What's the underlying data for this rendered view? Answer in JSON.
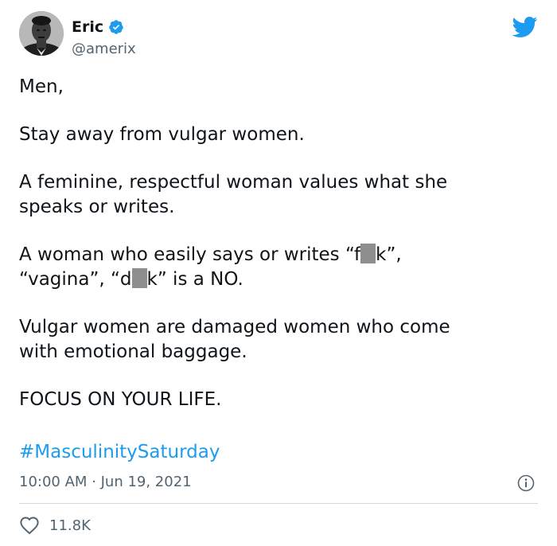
{
  "author": {
    "display_name": "Eric",
    "handle": "@amerix",
    "verified": true
  },
  "tweet": {
    "paragraphs": [
      [
        "Men,"
      ],
      [
        "Stay away from vulgar women."
      ],
      [
        "A feminine, respectful woman values what she",
        "speaks or writes."
      ],
      [
        "A woman who easily says or writes “f",
        "k”,",
        "“vagina”, “d",
        "k” is a NO."
      ],
      [
        "Vulgar women are damaged women who come",
        "with emotional baggage."
      ],
      [
        "FOCUS ON YOUR LIFE."
      ]
    ],
    "hashtag": "#MasculinitySaturday",
    "timestamp": "10:00 AM · Jun 19, 2021",
    "likes": "11.8K"
  },
  "icons": {
    "brand": "twitter-bird-icon",
    "verified": "verified-badge-icon",
    "info": "info-icon",
    "like": "heart-icon"
  },
  "colors": {
    "brand_blue": "#1d9bf0",
    "secondary_text": "#536471",
    "divider": "#cfd9de",
    "redaction": "#8e8e8e"
  }
}
